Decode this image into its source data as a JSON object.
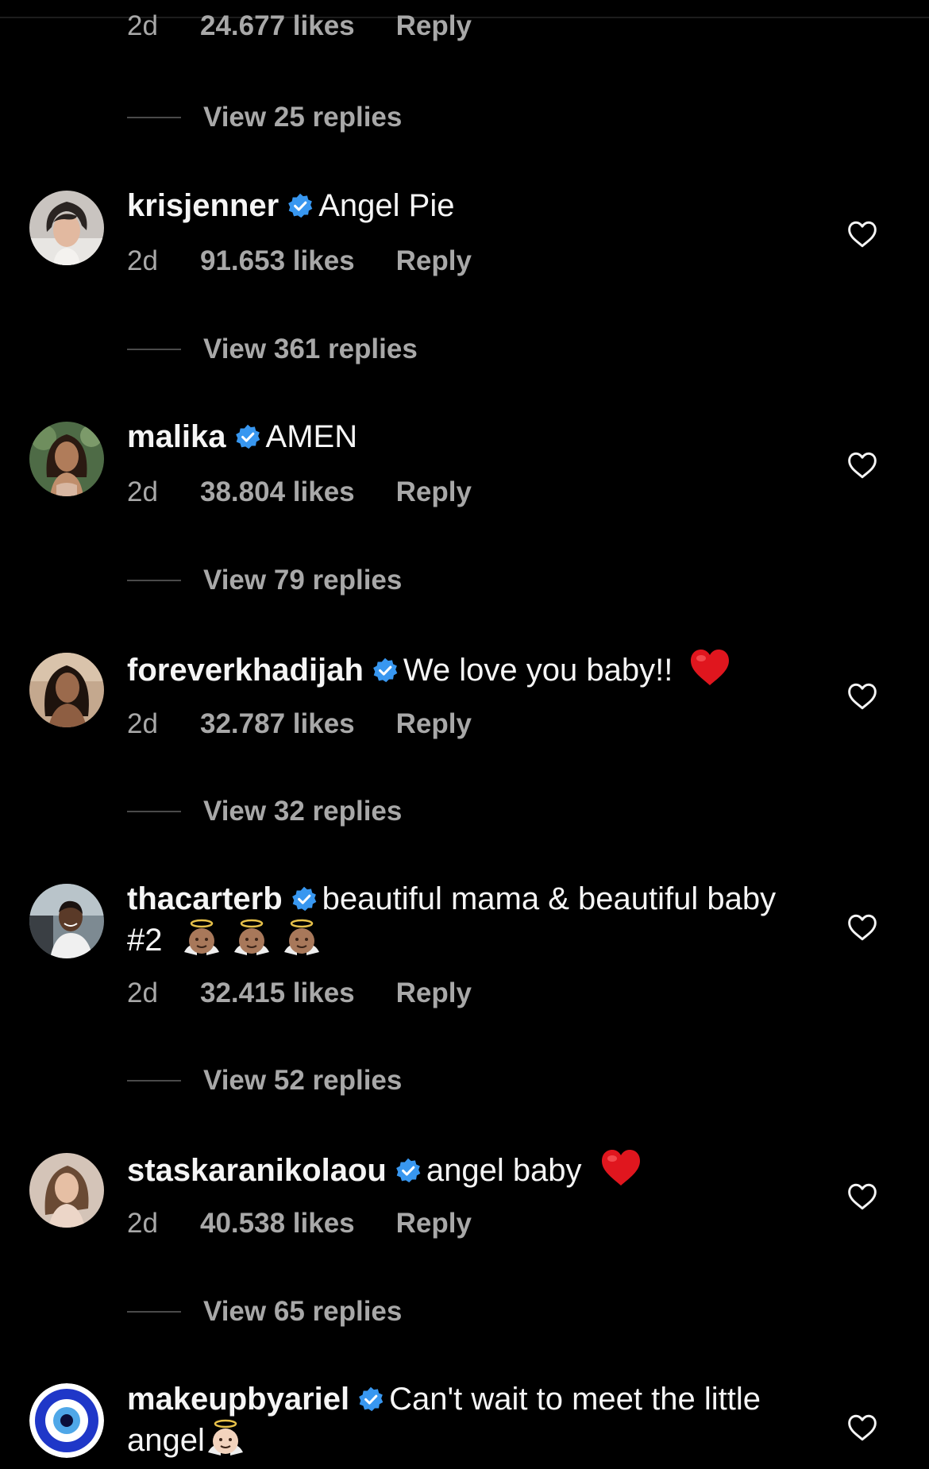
{
  "colors": {
    "background": "#000000",
    "primary_text": "#f5f5f5",
    "secondary_text": "#a8a8a8",
    "verified_blue": "#3897f0",
    "heart_red": "#e0161e"
  },
  "top_partial": {
    "time": "2d",
    "likes": "24.677 likes",
    "reply": "Reply",
    "view_replies": "View 25 replies"
  },
  "comments": [
    {
      "username": "krisjenner",
      "verified": true,
      "text": "Angel Pie",
      "time": "2d",
      "likes": "91.653 likes",
      "reply": "Reply",
      "view_replies": "View 361 replies",
      "avatar_icon": "profile-photo"
    },
    {
      "username": "malika",
      "verified": true,
      "text": "AMEN",
      "time": "2d",
      "likes": "38.804 likes",
      "reply": "Reply",
      "view_replies": "View 79 replies",
      "avatar_icon": "profile-photo"
    },
    {
      "username": "foreverkhadijah",
      "verified": true,
      "text": "We love you baby!!",
      "emoji": "red-heart-emoji",
      "time": "2d",
      "likes": "32.787 likes",
      "reply": "Reply",
      "view_replies": "View 32 replies",
      "avatar_icon": "profile-photo"
    },
    {
      "username": "thacarterb",
      "verified": true,
      "text": "beautiful mama & beautiful baby #2",
      "emoji": "baby-angel-emoji x3",
      "time": "2d",
      "likes": "32.415 likes",
      "reply": "Reply",
      "view_replies": "View 52 replies",
      "avatar_icon": "profile-photo"
    },
    {
      "username": "staskaranikolaou",
      "verified": true,
      "text": "angel baby",
      "emoji": "red-heart-emoji",
      "time": "2d",
      "likes": "40.538 likes",
      "reply": "Reply",
      "view_replies": "View 65 replies",
      "avatar_icon": "profile-photo"
    },
    {
      "username": "makeupbyariel",
      "verified": true,
      "text": "Can't wait to meet the little angel",
      "emoji": "baby-angel-emoji",
      "avatar_icon": "evil-eye-logo"
    }
  ]
}
